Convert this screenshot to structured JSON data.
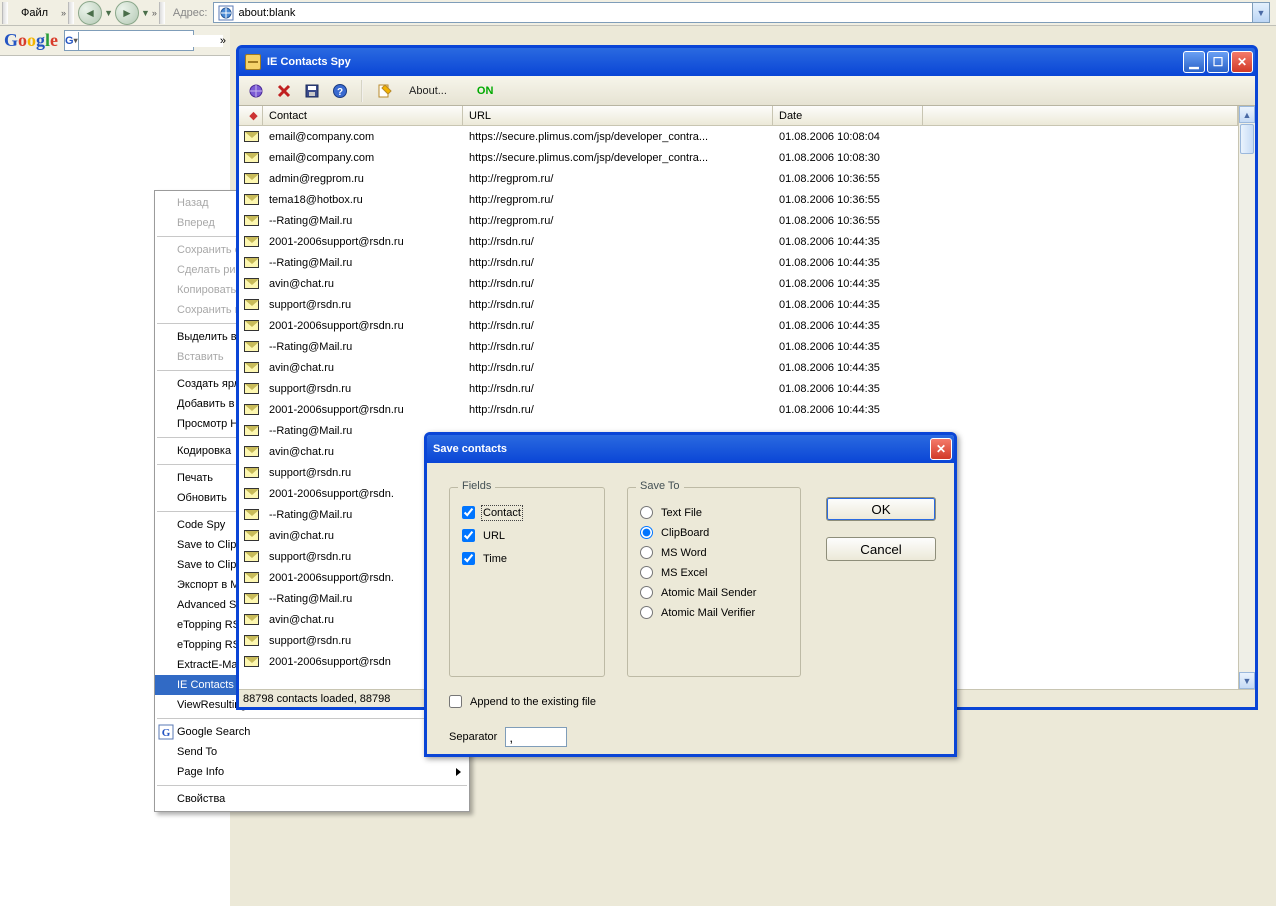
{
  "ie": {
    "file_label": "Файл",
    "addr_label": "Адрес:",
    "addr_value": "about:blank"
  },
  "ctx": {
    "items": [
      {
        "t": "Назад",
        "dis": true
      },
      {
        "t": "Вперед",
        "dis": true
      },
      {
        "sep": true
      },
      {
        "t": "Сохранить объект как...",
        "dis": true
      },
      {
        "t": "Сделать рисунком рабочего стола",
        "dis": true
      },
      {
        "t": "Копировать",
        "dis": true
      },
      {
        "t": "Сохранить как...",
        "dis": true
      },
      {
        "sep": true
      },
      {
        "t": "Выделить все"
      },
      {
        "t": "Вставить",
        "dis": true
      },
      {
        "sep": true
      },
      {
        "t": "Создать ярлык"
      },
      {
        "t": "Добавить в избранное..."
      },
      {
        "t": "Просмотр HTML-кода"
      },
      {
        "sep": true
      },
      {
        "t": "Кодировка",
        "arrow": true
      },
      {
        "sep": true
      },
      {
        "t": "Печать"
      },
      {
        "t": "Обновить"
      },
      {
        "sep": true
      },
      {
        "t": "Code Spy"
      },
      {
        "t": "Save to Clipboard"
      },
      {
        "t": "Save to ClipBoard (Table)"
      },
      {
        "t": "Экспорт в Microsoft Excel"
      },
      {
        "t": "Advanced Search"
      },
      {
        "t": "eTopping RSS Builder"
      },
      {
        "t": "eTopping RSS Reader"
      },
      {
        "t": "ExtractE-Mails"
      },
      {
        "t": "IE Contacts Spy",
        "sel": true
      },
      {
        "t": "ViewResulting Source"
      },
      {
        "sep": true
      },
      {
        "t": "Google Search",
        "ico": "g"
      },
      {
        "t": "Send To",
        "arrow": true
      },
      {
        "t": "Page Info",
        "arrow": true
      },
      {
        "sep": true
      },
      {
        "t": "Свойства"
      }
    ]
  },
  "win": {
    "title": "IE Contacts Spy",
    "about": "About...",
    "on": "ON",
    "cols": {
      "dot": "◆",
      "contact": "Contact",
      "url": "URL",
      "date": "Date"
    },
    "rows": [
      {
        "c": "email@company.com",
        "u": "https://secure.plimus.com/jsp/developer_contra...",
        "d": "01.08.2006  10:08:04"
      },
      {
        "c": "email@company.com",
        "u": "https://secure.plimus.com/jsp/developer_contra...",
        "d": "01.08.2006  10:08:30"
      },
      {
        "c": "admin@regprom.ru",
        "u": "http://regprom.ru/",
        "d": "01.08.2006  10:36:55"
      },
      {
        "c": "tema18@hotbox.ru",
        "u": "http://regprom.ru/",
        "d": "01.08.2006  10:36:55"
      },
      {
        "c": "--Rating@Mail.ru",
        "u": "http://regprom.ru/",
        "d": "01.08.2006  10:36:55"
      },
      {
        "c": "2001-2006support@rsdn.ru",
        "u": "http://rsdn.ru/",
        "d": "01.08.2006  10:44:35"
      },
      {
        "c": "--Rating@Mail.ru",
        "u": "http://rsdn.ru/",
        "d": "01.08.2006  10:44:35"
      },
      {
        "c": "avin@chat.ru",
        "u": "http://rsdn.ru/",
        "d": "01.08.2006  10:44:35"
      },
      {
        "c": "support@rsdn.ru",
        "u": "http://rsdn.ru/",
        "d": "01.08.2006  10:44:35"
      },
      {
        "c": "2001-2006support@rsdn.ru",
        "u": "http://rsdn.ru/",
        "d": "01.08.2006  10:44:35"
      },
      {
        "c": "--Rating@Mail.ru",
        "u": "http://rsdn.ru/",
        "d": "01.08.2006  10:44:35"
      },
      {
        "c": "avin@chat.ru",
        "u": "http://rsdn.ru/",
        "d": "01.08.2006  10:44:35"
      },
      {
        "c": "support@rsdn.ru",
        "u": "http://rsdn.ru/",
        "d": "01.08.2006  10:44:35"
      },
      {
        "c": "2001-2006support@rsdn.ru",
        "u": "http://rsdn.ru/",
        "d": "01.08.2006  10:44:35"
      },
      {
        "c": "--Rating@Mail.ru",
        "u": "",
        "d": ""
      },
      {
        "c": "avin@chat.ru",
        "u": "",
        "d": ""
      },
      {
        "c": "support@rsdn.ru",
        "u": "",
        "d": ""
      },
      {
        "c": "2001-2006support@rsdn.",
        "u": "",
        "d": ""
      },
      {
        "c": "--Rating@Mail.ru",
        "u": "",
        "d": ""
      },
      {
        "c": "avin@chat.ru",
        "u": "",
        "d": ""
      },
      {
        "c": "support@rsdn.ru",
        "u": "",
        "d": ""
      },
      {
        "c": "2001-2006support@rsdn.",
        "u": "",
        "d": ""
      },
      {
        "c": "--Rating@Mail.ru",
        "u": "",
        "d": ""
      },
      {
        "c": "avin@chat.ru",
        "u": "",
        "d": ""
      },
      {
        "c": "support@rsdn.ru",
        "u": "",
        "d": ""
      },
      {
        "c": "2001-2006support@rsdn",
        "u": "",
        "d": ""
      }
    ],
    "status": "88798 contacts loaded, 88798"
  },
  "dlg": {
    "title": "Save contacts",
    "fields_title": "Fields",
    "save_title": "Save To",
    "chk_contact": "Contact",
    "chk_url": "URL",
    "chk_time": "Time",
    "r_text": "Text File",
    "r_clip": "ClipBoard",
    "r_word": "MS Word",
    "r_excel": "MS Excel",
    "r_ams": "Atomic Mail Sender",
    "r_amv": "Atomic Mail Verifier",
    "ok": "OK",
    "cancel": "Cancel",
    "append": "Append to the existing file",
    "separator_label": "Separator",
    "separator_value": ","
  }
}
